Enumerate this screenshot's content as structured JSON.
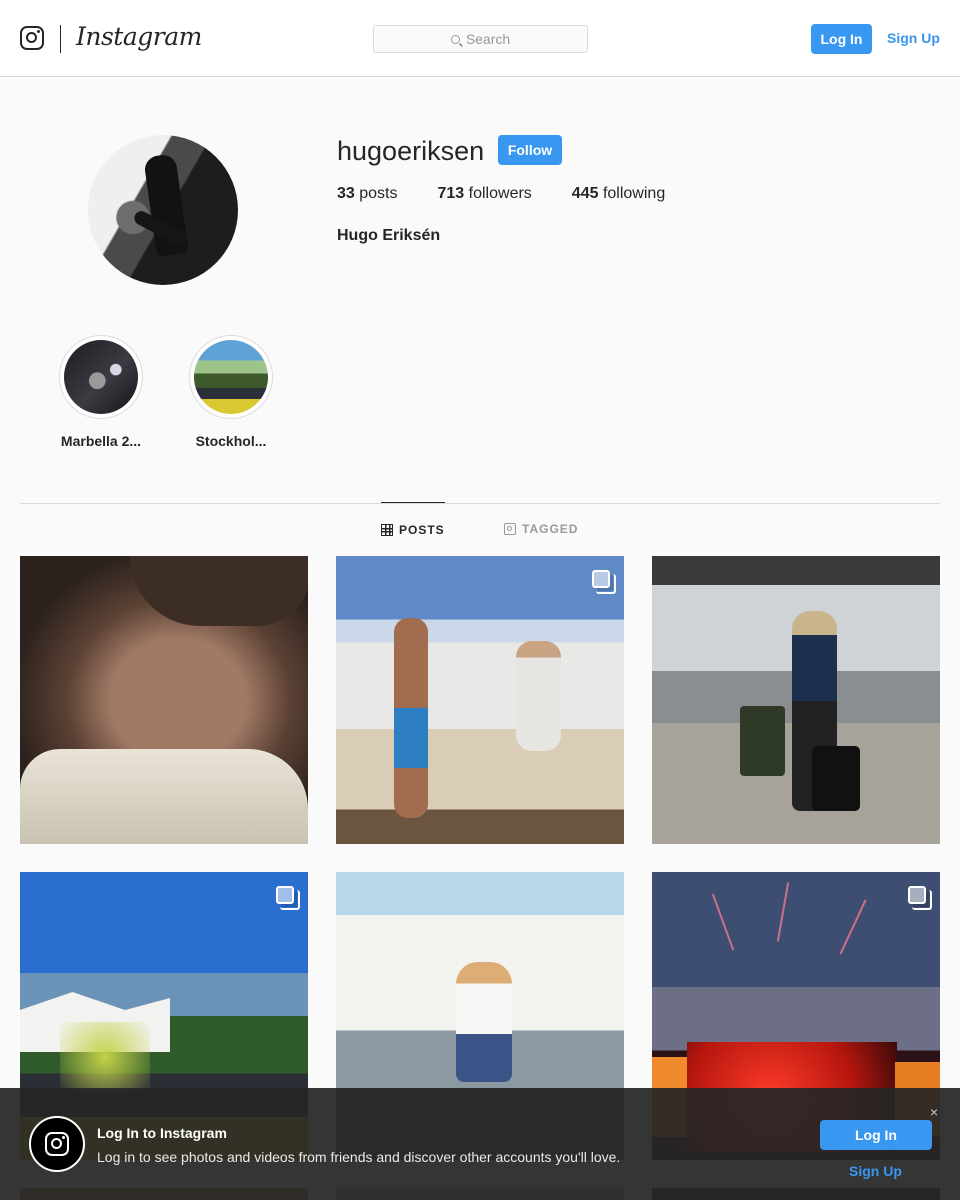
{
  "header": {
    "logo_text": "Instagram",
    "search_placeholder": "Search",
    "login_label": "Log In",
    "signup_label": "Sign Up"
  },
  "profile": {
    "username": "hugoeriksen",
    "follow_label": "Follow",
    "posts_count": "33",
    "posts_label": "posts",
    "followers_count": "713",
    "followers_label": "followers",
    "following_count": "445",
    "following_label": "following",
    "full_name": "Hugo Eriksén"
  },
  "highlights": [
    {
      "label": "Marbella 2..."
    },
    {
      "label": "Stockhol..."
    }
  ],
  "tabs": {
    "posts": "POSTS",
    "tagged": "TAGGED"
  },
  "banner": {
    "title": "Log In to Instagram",
    "text": "Log in to see photos and videos from friends and discover other accounts you'll love.",
    "login_label": "Log In",
    "signup_label": "Sign Up",
    "close_glyph": "×"
  },
  "colors": {
    "accent": "#3897f0",
    "text": "#262626",
    "background": "#fafafa"
  }
}
